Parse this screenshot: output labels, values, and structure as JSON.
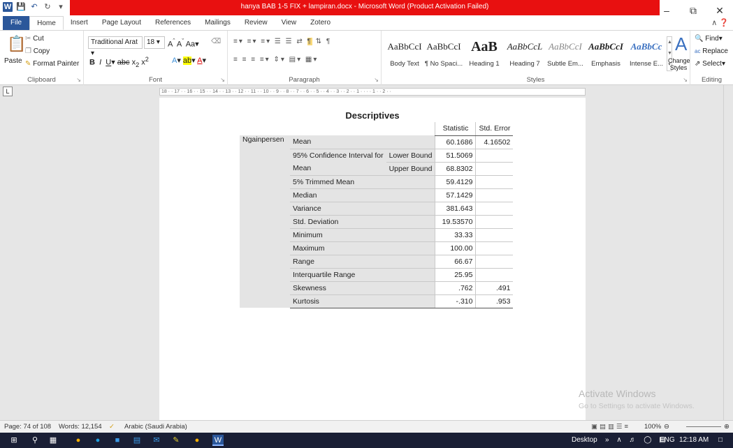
{
  "window": {
    "title": "hanya BAB 1-5 FIX + lampiran.docx  -  Microsoft Word (Product Activation Failed)"
  },
  "ribbon_tabs": [
    "File",
    "Home",
    "Insert",
    "Page Layout",
    "References",
    "Mailings",
    "Review",
    "View",
    "Zotero"
  ],
  "clipboard": {
    "paste": "Paste",
    "cut": "Cut",
    "copy": "Copy",
    "format_painter": "Format Painter",
    "label": "Clipboard"
  },
  "font": {
    "name": "Traditional Arat",
    "size": "18",
    "label": "Font"
  },
  "paragraph": {
    "label": "Paragraph"
  },
  "styles": {
    "label": "Styles",
    "items": [
      {
        "sample": "AaBbCcI",
        "name": "Body Text"
      },
      {
        "sample": "AaBbCcI",
        "name": "¶ No Spaci..."
      },
      {
        "sample": "AaB",
        "name": "Heading 1"
      },
      {
        "sample": "AaBbCcL",
        "name": "Heading 7"
      },
      {
        "sample": "AaBbCcI",
        "name": "Subtle Em..."
      },
      {
        "sample": "AaBbCcI",
        "name": "Emphasis"
      },
      {
        "sample": "AaBbCc",
        "name": "Intense E..."
      }
    ],
    "change_styles": "Change Styles"
  },
  "editing": {
    "find": "Find",
    "replace": "Replace",
    "select": "Select",
    "label": "Editing"
  },
  "document": {
    "table_title": "Descriptives",
    "headers": {
      "statistic": "Statistic",
      "std_error": "Std. Error"
    },
    "variable": "Ngainpersen",
    "rows": [
      {
        "name": "Mean",
        "sub": "",
        "stat": "60.1686",
        "err": "4.16502"
      },
      {
        "name": "95% Confidence Interval for",
        "sub": "Lower Bound",
        "stat": "51.5069",
        "err": ""
      },
      {
        "name": "Mean",
        "sub": "Upper Bound",
        "stat": "68.8302",
        "err": ""
      },
      {
        "name": "5% Trimmed Mean",
        "sub": "",
        "stat": "59.4129",
        "err": ""
      },
      {
        "name": "Median",
        "sub": "",
        "stat": "57.1429",
        "err": ""
      },
      {
        "name": "Variance",
        "sub": "",
        "stat": "381.643",
        "err": ""
      },
      {
        "name": "Std. Deviation",
        "sub": "",
        "stat": "19.53570",
        "err": ""
      },
      {
        "name": "Minimum",
        "sub": "",
        "stat": "33.33",
        "err": ""
      },
      {
        "name": "Maximum",
        "sub": "",
        "stat": "100.00",
        "err": ""
      },
      {
        "name": "Range",
        "sub": "",
        "stat": "66.67",
        "err": ""
      },
      {
        "name": "Interquartile Range",
        "sub": "",
        "stat": "25.95",
        "err": ""
      },
      {
        "name": "Skewness",
        "sub": "",
        "stat": ".762",
        "err": ".491"
      },
      {
        "name": "Kurtosis",
        "sub": "",
        "stat": "-.310",
        "err": ".953"
      }
    ]
  },
  "watermark": {
    "line1": "Activate Windows",
    "line2": "Go to Settings to activate Windows."
  },
  "status": {
    "page": "Page: 74 of 108",
    "words": "Words: 12,154",
    "language": "Arabic (Saudi Arabia)",
    "zoom": "100%"
  },
  "taskbar": {
    "desktop": "Desktop",
    "lang": "ENG",
    "time": "12:18 AM"
  },
  "colors": {
    "title_band": "#e81010",
    "file_tab": "#2b579a",
    "taskbar": "#1a1f35"
  }
}
